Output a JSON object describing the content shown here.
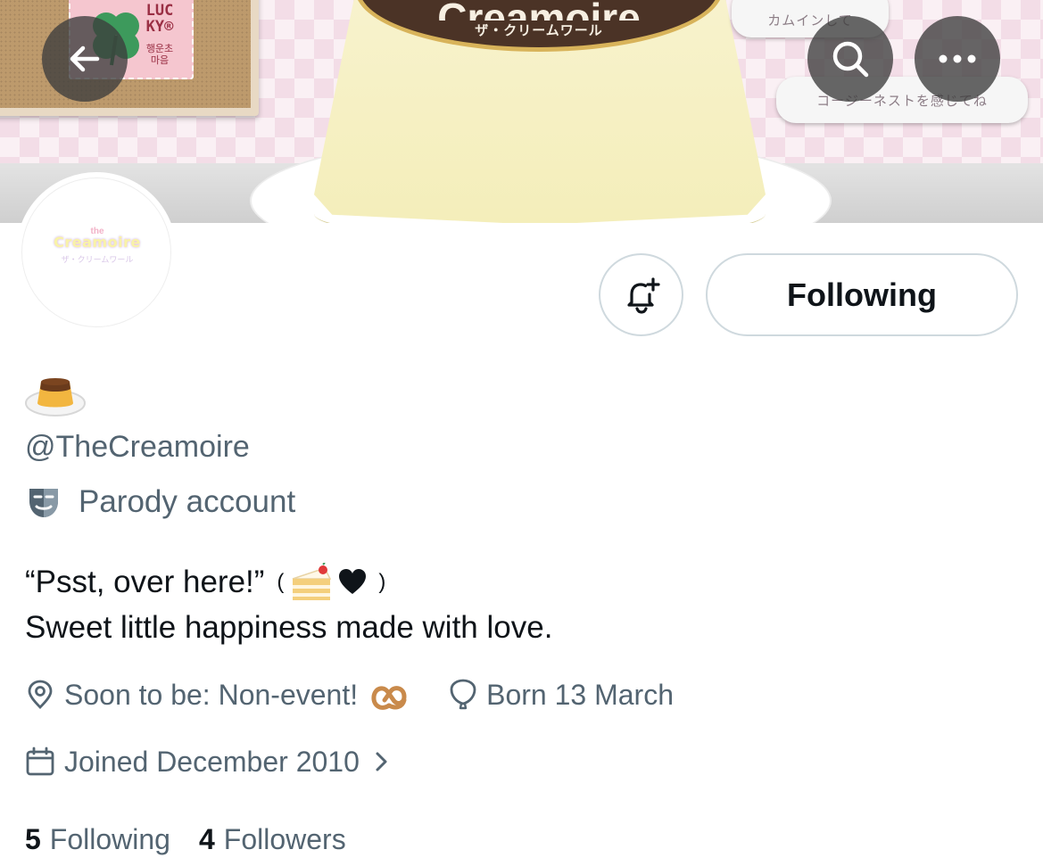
{
  "banner": {
    "stamp_text": "LUC\nKY®",
    "stamp_subtext": "행운초\n마음",
    "pudding_title": "Creamoire",
    "pudding_subtitle": "ザ・クリームワール",
    "bubble_1": "カムインして",
    "bubble_2": "コージーネストを感じてね"
  },
  "header": {
    "back_icon": "arrow-left-icon",
    "search_icon": "search-icon",
    "more_icon": "more-dots-icon"
  },
  "avatar": {
    "logo_top": "the",
    "logo_text": "Creamoire",
    "logo_sub": "ザ・クリームワール"
  },
  "actions": {
    "notify_icon": "bell-plus-icon",
    "following_label": "Following"
  },
  "profile": {
    "name_emoji": "pudding-emoji",
    "handle": "@TheCreamoire",
    "parody_label": "Parody account",
    "bio_line_1": "“Psst, over here!”",
    "bio_paren_open": "(",
    "bio_paren_close": ")",
    "bio_line_2": "Sweet little happiness made with love.",
    "location": "Soon to be: Non-event!",
    "birthday": "Born 13 March",
    "joined": "Joined December 2010"
  },
  "stats": {
    "following_count": "5",
    "following_label": "Following",
    "followers_count": "4",
    "followers_label": "Followers"
  },
  "colors": {
    "text_primary": "#0f1419",
    "text_secondary": "#536471",
    "border": "#cfd9de",
    "banner_pink": "#f3dde7"
  }
}
